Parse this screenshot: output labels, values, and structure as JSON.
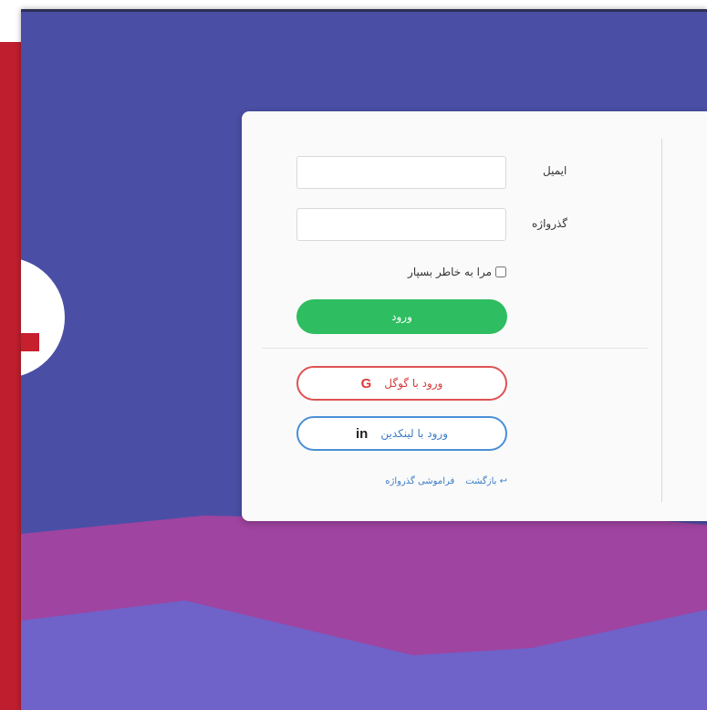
{
  "login": {
    "email_label": "ایمیل",
    "email_value": "",
    "password_label": "گذرواژه",
    "password_value": "",
    "remember_label": "مرا به خاطر بسپار",
    "login_button": "ورود",
    "google_button": "ورود با گوگل",
    "google_icon": "G",
    "linkedin_button": "ورود با لینکدین",
    "linkedin_icon": "in",
    "back_link": "↩ بازگشت",
    "forgot_link": "فراموشی گذرواژه"
  },
  "colors": {
    "background_red": "#bf1e2e",
    "window_blue": "#4a4fa5",
    "wave_purple": "#9f44a0",
    "wave_lavender": "#6f62c9",
    "login_green": "#2ebd60",
    "google_red": "#e05252",
    "linkedin_blue": "#4a8fd6"
  }
}
